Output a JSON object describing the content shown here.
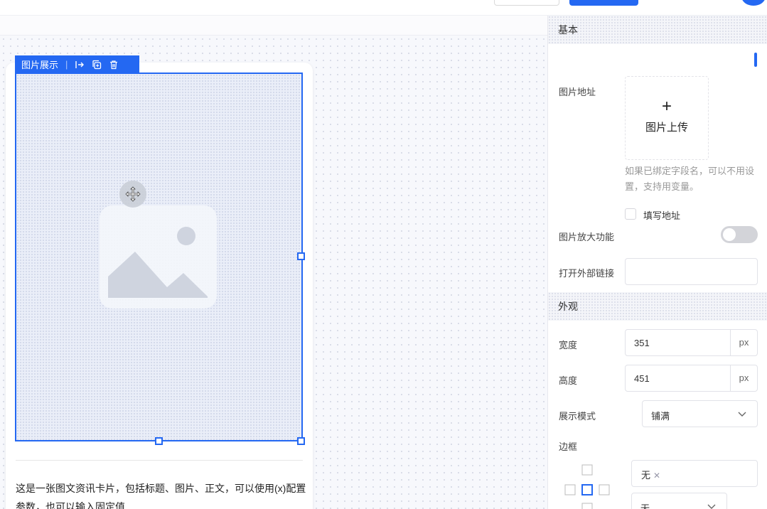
{
  "component": {
    "toolbar_title": "图片展示",
    "toolbar_separator": "|",
    "description": "这是一张图文资讯卡片，包括标题、图片、正文，可以使用(x)配置参数，也可以输入固定值"
  },
  "panel": {
    "section_basic": "基本",
    "image_url_label": "图片地址",
    "upload_plus": "+",
    "upload_label": "图片上传",
    "upload_hint": "如果已绑定字段名，可以不用设置，支持用变量。",
    "fill_url_label": "填写地址",
    "zoom_label": "图片放大功能",
    "zoom_enabled": false,
    "open_link_label": "打开外部链接",
    "open_link_value": "",
    "section_appearance": "外观",
    "width_label": "宽度",
    "width_value": "351",
    "width_unit": "px",
    "height_label": "高度",
    "height_value": "451",
    "height_unit": "px",
    "display_mode_label": "展示模式",
    "display_mode_value": "铺满",
    "border_label": "边框",
    "border_tag": "无",
    "border_style_value": "无"
  },
  "colors": {
    "accent": "#2468f2",
    "canvas_bg": "#f7f8fc",
    "toggle_off": "#d3d4d9"
  }
}
